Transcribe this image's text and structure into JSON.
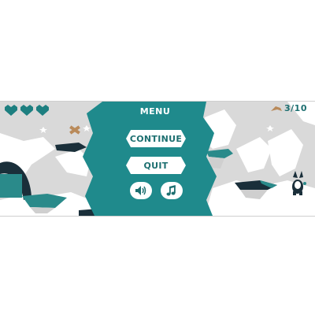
{
  "hud": {
    "hearts": 3,
    "collected_count": "3/10",
    "colors": {
      "heart": "#1d7f80",
      "counter_text": "#1d6f70",
      "item": "#b98a5a"
    }
  },
  "menu": {
    "title": "MENU",
    "continue_label": "CONTINUE",
    "quit_label": "QUIT",
    "sound_icon": "speaker-icon",
    "music_icon": "music-note-icon",
    "panel_color": "#1f8a8c"
  },
  "scene": {
    "background_color": "#d8d8d8",
    "snow_color": "#ffffff",
    "platform_color": "#2a8a8a",
    "dark_color": "#1a2f3a"
  }
}
